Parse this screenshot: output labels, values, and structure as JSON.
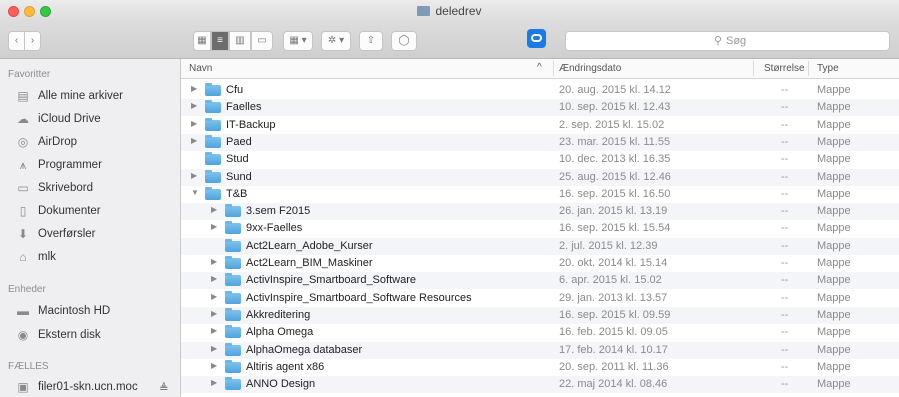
{
  "window": {
    "title": "deledrev"
  },
  "toolbar": {
    "search_placeholder": "Søg",
    "search_icon": "magnifier-icon",
    "view_icons": [
      "icon-view-icon",
      "list-view-icon",
      "column-view-icon",
      "cover-flow-icon",
      "arrange-icon",
      "action-gear-icon",
      "share-icon",
      "tag-icon"
    ]
  },
  "sidebar": {
    "favorites_title": "Favoritter",
    "favorites": [
      {
        "label": "Alle mine arkiver",
        "icon": "all-files-icon"
      },
      {
        "label": "iCloud Drive",
        "icon": "cloud-icon"
      },
      {
        "label": "AirDrop",
        "icon": "airdrop-icon"
      },
      {
        "label": "Programmer",
        "icon": "applications-icon"
      },
      {
        "label": "Skrivebord",
        "icon": "desktop-icon"
      },
      {
        "label": "Dokumenter",
        "icon": "documents-icon"
      },
      {
        "label": "Overførsler",
        "icon": "downloads-icon"
      },
      {
        "label": "mlk",
        "icon": "home-icon"
      }
    ],
    "devices_title": "Enheder",
    "devices": [
      {
        "label": "Macintosh HD",
        "icon": "hard-disk-icon"
      },
      {
        "label": "Ekstern disk",
        "icon": "external-disk-icon"
      }
    ],
    "shared_title": "FÆLLES",
    "shared": [
      {
        "label": "filer01-skn.ucn.moc",
        "icon": "server-icon",
        "eject": "≜"
      }
    ]
  },
  "list": {
    "columns": {
      "name": "Navn",
      "sort_indicator": "^",
      "date": "Ændringsdato",
      "size": "Størrelse",
      "kind": "Type"
    },
    "rows": [
      {
        "name": "Cfu",
        "date": "20. aug. 2015 kl. 14.12",
        "size": "--",
        "kind": "Mappe",
        "level": 0,
        "disclosure": "closed"
      },
      {
        "name": "Faelles",
        "date": "10. sep. 2015 kl. 12.43",
        "size": "--",
        "kind": "Mappe",
        "level": 0,
        "disclosure": "closed"
      },
      {
        "name": "IT-Backup",
        "date": "2. sep. 2015 kl. 15.02",
        "size": "--",
        "kind": "Mappe",
        "level": 0,
        "disclosure": "closed"
      },
      {
        "name": "Paed",
        "date": "23. mar. 2015 kl. 11.55",
        "size": "--",
        "kind": "Mappe",
        "level": 0,
        "disclosure": "closed"
      },
      {
        "name": "Stud",
        "date": "10. dec. 2013 kl. 16.35",
        "size": "--",
        "kind": "Mappe",
        "level": 0,
        "disclosure": "none"
      },
      {
        "name": "Sund",
        "date": "25. aug. 2015 kl. 12.46",
        "size": "--",
        "kind": "Mappe",
        "level": 0,
        "disclosure": "closed"
      },
      {
        "name": "T&B",
        "date": "16. sep. 2015 kl. 16.50",
        "size": "--",
        "kind": "Mappe",
        "level": 0,
        "disclosure": "open"
      },
      {
        "name": "3.sem F2015",
        "date": "26. jan. 2015 kl. 13.19",
        "size": "--",
        "kind": "Mappe",
        "level": 1,
        "disclosure": "closed"
      },
      {
        "name": "9xx-Faelles",
        "date": "16. sep. 2015 kl. 15.54",
        "size": "--",
        "kind": "Mappe",
        "level": 1,
        "disclosure": "closed"
      },
      {
        "name": "Act2Learn_Adobe_Kurser",
        "date": "2. jul. 2015 kl. 12.39",
        "size": "--",
        "kind": "Mappe",
        "level": 1,
        "disclosure": "none"
      },
      {
        "name": "Act2Learn_BIM_Maskiner",
        "date": "20. okt. 2014 kl. 15.14",
        "size": "--",
        "kind": "Mappe",
        "level": 1,
        "disclosure": "closed"
      },
      {
        "name": "ActivInspire_Smartboard_Software",
        "date": "6. apr. 2015 kl. 15.02",
        "size": "--",
        "kind": "Mappe",
        "level": 1,
        "disclosure": "closed"
      },
      {
        "name": "ActivInspire_Smartboard_Software Resources",
        "date": "29. jan. 2013 kl. 13.57",
        "size": "--",
        "kind": "Mappe",
        "level": 1,
        "disclosure": "closed"
      },
      {
        "name": "Akkreditering",
        "date": "16. sep. 2015 kl. 09.59",
        "size": "--",
        "kind": "Mappe",
        "level": 1,
        "disclosure": "closed"
      },
      {
        "name": "Alpha Omega",
        "date": "16. feb. 2015 kl. 09.05",
        "size": "--",
        "kind": "Mappe",
        "level": 1,
        "disclosure": "closed"
      },
      {
        "name": "AlphaOmega databaser",
        "date": "17. feb. 2014 kl. 10.17",
        "size": "--",
        "kind": "Mappe",
        "level": 1,
        "disclosure": "closed"
      },
      {
        "name": "Altiris agent x86",
        "date": "20. sep. 2011 kl. 11.36",
        "size": "--",
        "kind": "Mappe",
        "level": 1,
        "disclosure": "closed"
      },
      {
        "name": "ANNO Design",
        "date": "22. maj 2014 kl. 08.46",
        "size": "--",
        "kind": "Mappe",
        "level": 1,
        "disclosure": "closed"
      }
    ]
  }
}
